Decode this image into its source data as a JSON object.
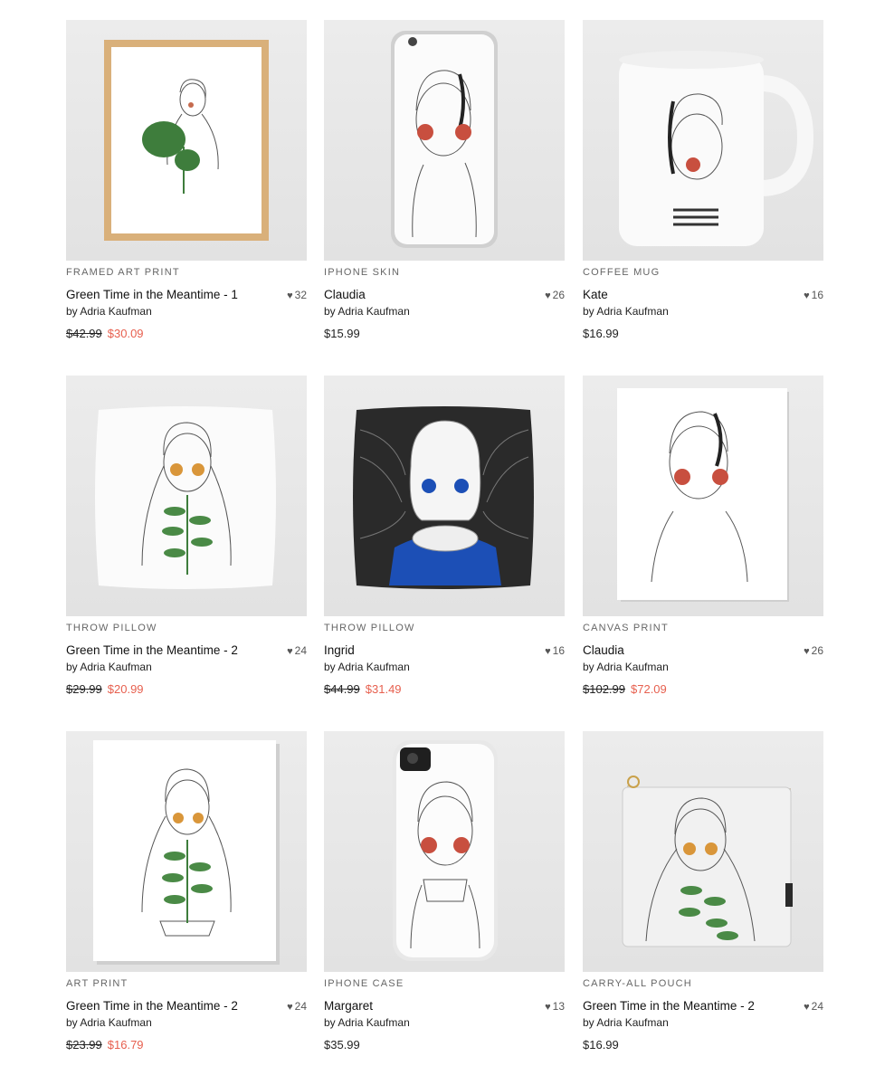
{
  "accent_sale_color": "#e7604f",
  "products": [
    {
      "type": "FRAMED ART PRINT",
      "title": "Green Time in the Meantime - 1",
      "likes": "32",
      "by_prefix": "by",
      "artist": "Adria Kaufman",
      "old_price": "$42.99",
      "price": "$30.09",
      "on_sale": true,
      "image": "framed-print"
    },
    {
      "type": "IPHONE SKIN",
      "title": "Claudia",
      "likes": "26",
      "by_prefix": "by",
      "artist": "Adria Kaufman",
      "old_price": "",
      "price": "$15.99",
      "on_sale": false,
      "image": "iphone-skin"
    },
    {
      "type": "COFFEE MUG",
      "title": "Kate",
      "likes": "16",
      "by_prefix": "by",
      "artist": "Adria Kaufman",
      "old_price": "",
      "price": "$16.99",
      "on_sale": false,
      "image": "mug"
    },
    {
      "type": "THROW PILLOW",
      "title": "Green Time in the Meantime - 2",
      "likes": "24",
      "by_prefix": "by",
      "artist": "Adria Kaufman",
      "old_price": "$29.99",
      "price": "$20.99",
      "on_sale": true,
      "image": "pillow-white"
    },
    {
      "type": "THROW PILLOW",
      "title": "Ingrid",
      "likes": "16",
      "by_prefix": "by",
      "artist": "Adria Kaufman",
      "old_price": "$44.99",
      "price": "$31.49",
      "on_sale": true,
      "image": "pillow-dark"
    },
    {
      "type": "CANVAS PRINT",
      "title": "Claudia",
      "likes": "26",
      "by_prefix": "by",
      "artist": "Adria Kaufman",
      "old_price": "$102.99",
      "price": "$72.09",
      "on_sale": true,
      "image": "canvas"
    },
    {
      "type": "ART PRINT",
      "title": "Green Time in the Meantime - 2",
      "likes": "24",
      "by_prefix": "by",
      "artist": "Adria Kaufman",
      "old_price": "$23.99",
      "price": "$16.79",
      "on_sale": true,
      "image": "art-print"
    },
    {
      "type": "IPHONE CASE",
      "title": "Margaret",
      "likes": "13",
      "by_prefix": "by",
      "artist": "Adria Kaufman",
      "old_price": "",
      "price": "$35.99",
      "on_sale": false,
      "image": "iphone-case"
    },
    {
      "type": "CARRY-ALL POUCH",
      "title": "Green Time in the Meantime - 2",
      "likes": "24",
      "by_prefix": "by",
      "artist": "Adria Kaufman",
      "old_price": "",
      "price": "$16.99",
      "on_sale": false,
      "image": "pouch"
    }
  ]
}
